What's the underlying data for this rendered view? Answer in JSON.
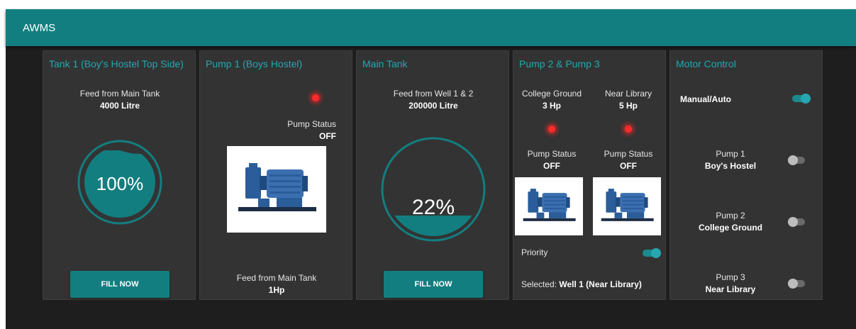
{
  "app": {
    "title": "AWMS"
  },
  "colors": {
    "accent": "#137e80",
    "led_off": "#ff2a2a",
    "card": "#333333"
  },
  "tank1": {
    "title": "Tank 1 (Boy's Hostel Top Side)",
    "feed_label": "Feed from Main Tank",
    "capacity": "4000 Litre",
    "level_text": "100%",
    "level_fraction": 1.0,
    "button_label": "FILL NOW"
  },
  "pump1": {
    "title": "Pump 1 (Boys Hostel)",
    "status_label": "Pump Status",
    "status_value": "OFF",
    "pump_icon": "centrifugal-pump-icon",
    "feed_label": "Feed from Main Tank",
    "power": "1Hp"
  },
  "main_tank": {
    "title": "Main Tank",
    "feed_label": "Feed from Well 1 & 2",
    "capacity": "200000 Litre",
    "level_text": "22%",
    "level_fraction": 0.22,
    "button_label": "FILL NOW"
  },
  "pump23": {
    "title": "Pump 2 & Pump 3",
    "left": {
      "location": "College Ground",
      "power": "3 Hp",
      "status_label": "Pump Status",
      "status_value": "OFF"
    },
    "right": {
      "location": "Near Library",
      "power": "5 Hp",
      "status_label": "Pump Status",
      "status_value": "OFF"
    },
    "priority_label": "Priority",
    "priority_on": true,
    "selected_label": "Selected:",
    "selected_value": "Well 1 (Near Library)"
  },
  "motor_control": {
    "title": "Motor Control",
    "manual_auto_label": "Manual/Auto",
    "manual_auto_on": true,
    "pumps": [
      {
        "name": "Pump 1",
        "location": "Boy's Hostel",
        "on": false
      },
      {
        "name": "Pump 2",
        "location": "College Ground",
        "on": false
      },
      {
        "name": "Pump 3",
        "location": "Near Library",
        "on": false
      }
    ]
  }
}
